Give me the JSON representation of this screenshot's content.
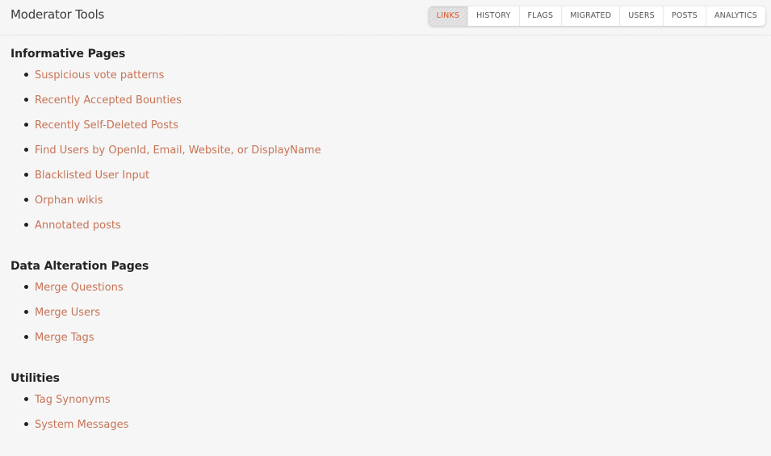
{
  "header": {
    "title": "Moderator Tools"
  },
  "tabs": [
    {
      "label": "LINKS",
      "active": true
    },
    {
      "label": "HISTORY",
      "active": false
    },
    {
      "label": "FLAGS",
      "active": false
    },
    {
      "label": "MIGRATED",
      "active": false
    },
    {
      "label": "USERS",
      "active": false
    },
    {
      "label": "POSTS",
      "active": false
    },
    {
      "label": "ANALYTICS",
      "active": false
    }
  ],
  "sections": [
    {
      "title": "Informative Pages",
      "links": [
        "Suspicious vote patterns",
        "Recently Accepted Bounties",
        "Recently Self-Deleted Posts",
        "Find Users by OpenId, Email, Website, or DisplayName",
        "Blacklisted User Input",
        "Orphan wikis",
        "Annotated posts"
      ]
    },
    {
      "title": "Data Alteration Pages",
      "links": [
        "Merge Questions",
        "Merge Users",
        "Merge Tags"
      ]
    },
    {
      "title": "Utilities",
      "links": [
        "Tag Synonyms",
        "System Messages"
      ]
    }
  ],
  "colors": {
    "link": "#c77356",
    "active_tab": "#e0582b",
    "background": "#f6f6f6"
  }
}
